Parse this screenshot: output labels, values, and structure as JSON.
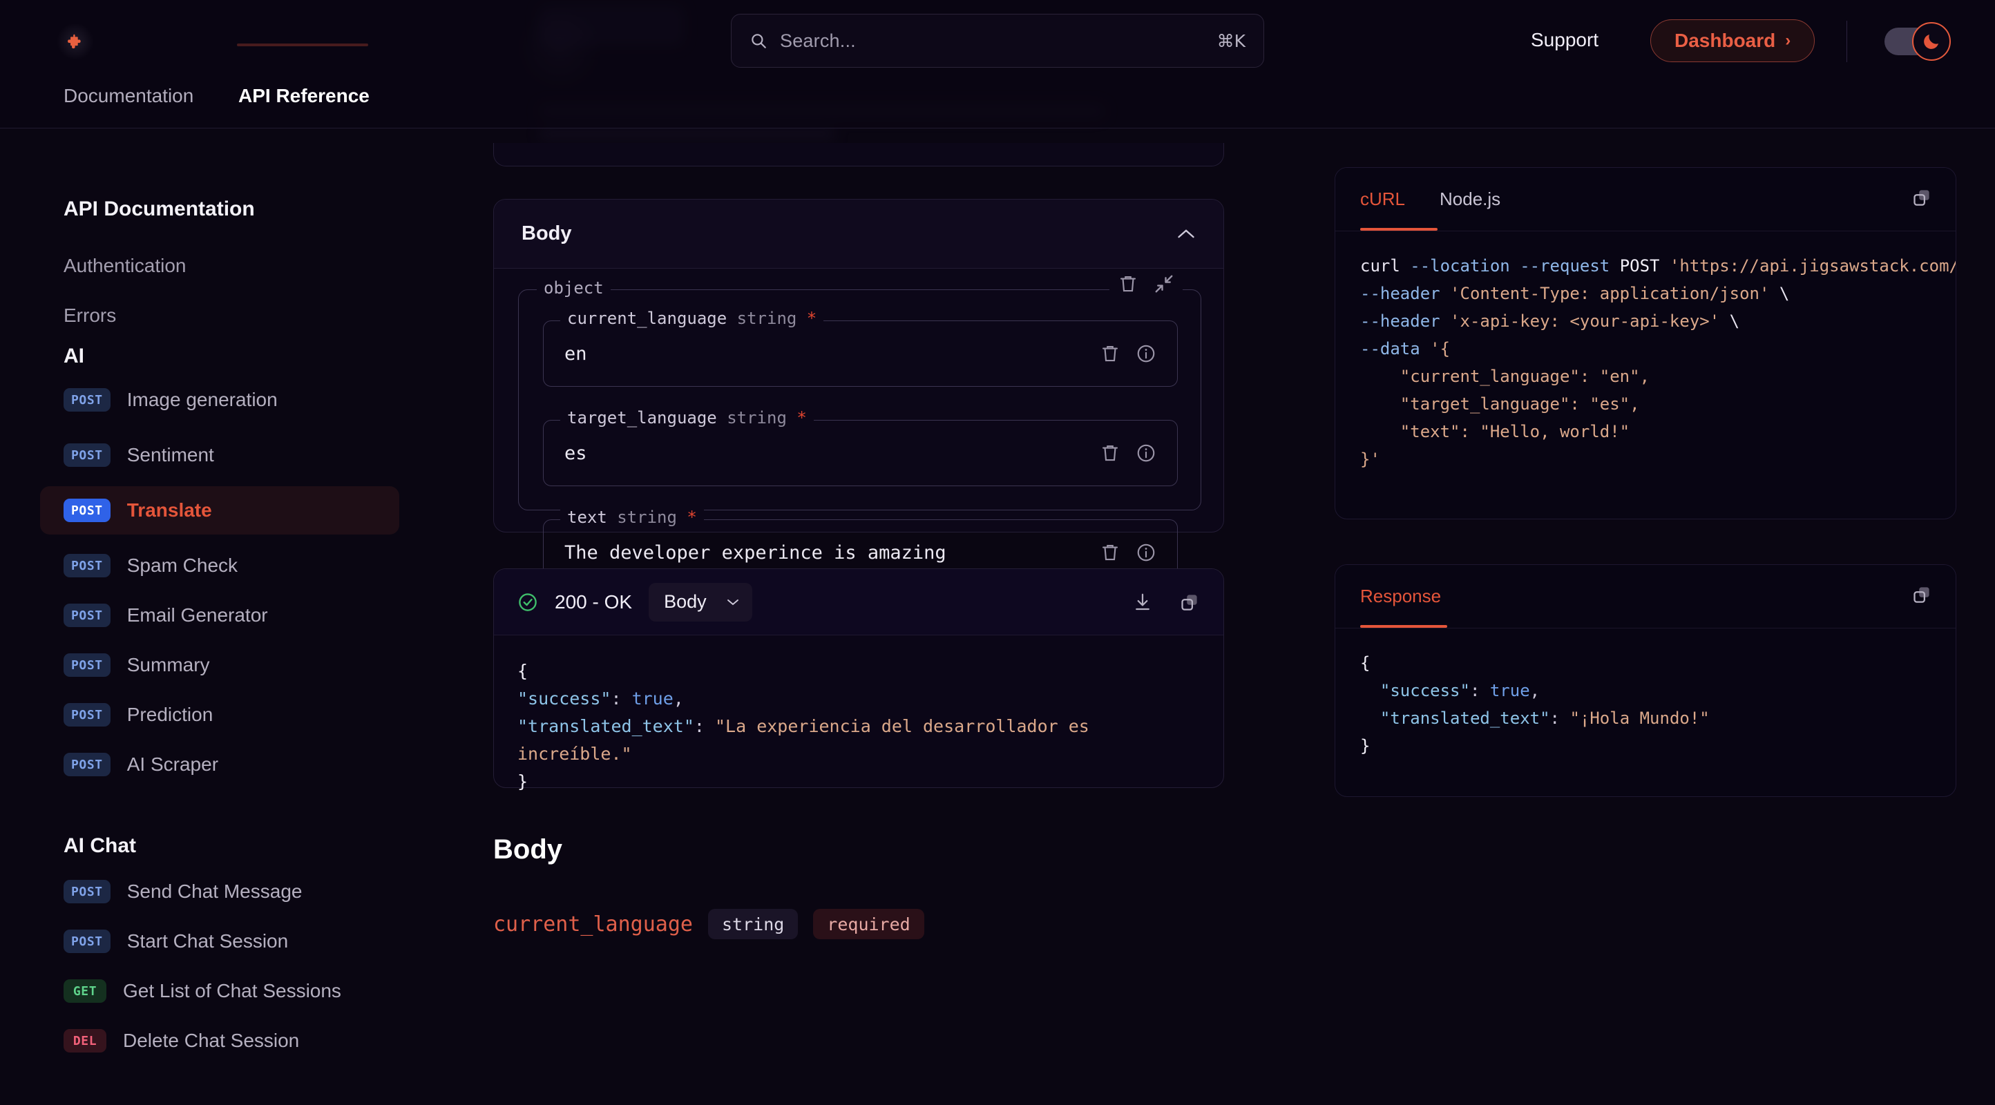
{
  "header": {
    "logo_icon": "jigsaw-puzzle-piece-icon",
    "search": {
      "icon": "search-icon",
      "placeholder": "Search...",
      "shortcut": "⌘K"
    },
    "support_label": "Support",
    "dashboard_label": "Dashboard",
    "dashboard_chevron": "›",
    "theme_toggle_icon": "moon-icon",
    "accent_color": "#e4553a"
  },
  "tabs": [
    {
      "label": "Documentation",
      "active": false
    },
    {
      "label": "API Reference",
      "active": true
    }
  ],
  "sidebar": {
    "title": "API Documentation",
    "links": [
      {
        "label": "Authentication"
      },
      {
        "label": "Errors"
      }
    ],
    "groups": [
      {
        "label": "AI",
        "items": [
          {
            "method": "POST",
            "label": "Image generation",
            "active": false
          },
          {
            "method": "POST",
            "label": "Sentiment",
            "active": false
          },
          {
            "method": "POST",
            "label": "Translate",
            "active": true
          },
          {
            "method": "POST",
            "label": "Spam Check",
            "active": false
          },
          {
            "method": "POST",
            "label": "Email Generator",
            "active": false
          },
          {
            "method": "POST",
            "label": "Summary",
            "active": false
          },
          {
            "method": "POST",
            "label": "Prediction",
            "active": false
          },
          {
            "method": "POST",
            "label": "AI Scraper",
            "active": false
          }
        ]
      },
      {
        "label": "AI Chat",
        "items": [
          {
            "method": "POST",
            "label": "Send Chat Message",
            "active": false
          },
          {
            "method": "POST",
            "label": "Start Chat Session",
            "active": false
          },
          {
            "method": "GET",
            "label": "Get List of Chat Sessions",
            "active": false
          },
          {
            "method": "DEL",
            "label": "Delete Chat Session",
            "active": false
          }
        ]
      }
    ]
  },
  "body_panel": {
    "title": "Body",
    "collapse_icon": "chevron-up-icon",
    "object": {
      "legend": "object",
      "delete_icon": "trash-icon",
      "collapse_icon": "collapse-arrows-icon"
    },
    "fields": [
      {
        "name": "current_language",
        "type": "string",
        "required_marker": "*",
        "value": "en",
        "delete_icon": "trash-icon",
        "info_icon": "info-circle-icon"
      },
      {
        "name": "target_language",
        "type": "string",
        "required_marker": "*",
        "value": "es",
        "delete_icon": "trash-icon",
        "info_icon": "info-circle-icon"
      },
      {
        "name": "text",
        "type": "string",
        "required_marker": "*",
        "value": "The developer experince is amazing",
        "delete_icon": "trash-icon",
        "info_icon": "info-circle-icon"
      }
    ],
    "add_field_label": "+"
  },
  "response_panel": {
    "status_icon": "check-circle-icon",
    "status_text": "200 - OK",
    "select_value": "Body",
    "select_chevron": "chevron-down-icon",
    "download_icon": "download-icon",
    "copy_icon": "copy-icon",
    "json": {
      "open_brace": "{",
      "line1_key": "\"success\"",
      "line1_colon": ": ",
      "line1_value": "true",
      "line1_comma": ",",
      "line2_key": "\"translated_text\"",
      "line2_colon": ": ",
      "line2_value": "\"La experiencia del desarrollador es increíble.\"",
      "close_brace": "}"
    }
  },
  "bottom_section": {
    "title": "Body",
    "param": {
      "name": "current_language",
      "type_pill": "string",
      "required_pill": "required"
    }
  },
  "code_panel": {
    "tabs": [
      {
        "label": "cURL",
        "active": true
      },
      {
        "label": "Node.js",
        "active": false
      }
    ],
    "copy_icon": "copy-icon",
    "curl": {
      "l1_cmd": "curl",
      "l1_flag1": " --location",
      "l1_flag2": " --request",
      "l1_method": " POST",
      "l1_url": " 'https://api.jigsawstack.com/",
      "l2_flag": "--header",
      "l2_str": " 'Content-Type: application/json'",
      "l2_cont": " \\",
      "l3_flag": "--header",
      "l3_str": " 'x-api-key: <your-api-key>'",
      "l3_cont": " \\",
      "l4_flag": "--data",
      "l4_open": " '{",
      "l5": "    \"current_language\": \"en\",",
      "l6": "    \"target_language\": \"es\",",
      "l7": "    \"text\": \"Hello, world!\"",
      "l8": "}'"
    }
  },
  "response_code_panel": {
    "tab_label": "Response",
    "copy_icon": "copy-icon",
    "json": {
      "open_brace": "{",
      "line1_key": "\"success\"",
      "line1_colon": ": ",
      "line1_value": "true",
      "line1_comma": ",",
      "line2_key": "\"translated_text\"",
      "line2_colon": ": ",
      "line2_value": "\"¡Hola Mundo!\"",
      "close_brace": "}"
    }
  }
}
